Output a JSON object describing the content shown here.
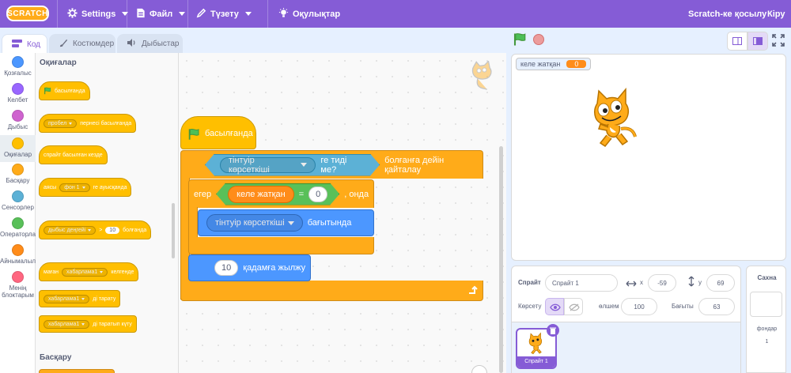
{
  "menu": {
    "logo": "SCRATCH",
    "settings": "Settings",
    "file": "Файл",
    "edit": "Түзету",
    "tutorials": "Оқулықтар",
    "join": "Scratch-ке қосылу",
    "signin": "Кіру"
  },
  "tabs": {
    "code": "Код",
    "costumes": "Костюмдер",
    "sounds": "Дыбыстар"
  },
  "categories": [
    {
      "label": "Қозғалыс",
      "color": "#4c97ff"
    },
    {
      "label": "Келбет",
      "color": "#9966ff"
    },
    {
      "label": "Дыбыс",
      "color": "#cf63cf"
    },
    {
      "label": "Оқиғалар",
      "color": "#ffbf00"
    },
    {
      "label": "Басқару",
      "color": "#ffab19"
    },
    {
      "label": "Сенсорлер",
      "color": "#5cb1d6"
    },
    {
      "label": "Операторлар",
      "color": "#59c059"
    },
    {
      "label": "Айнымалылар",
      "color": "#ff8c1a"
    },
    {
      "label": "Менің блоктарым",
      "color": "#ff6680"
    }
  ],
  "palette": {
    "events_title": "Оқиғалар",
    "control_title": "Басқару",
    "b_flag": "басылғанда",
    "b_key_dd": "пробел",
    "b_key": "пернесі басылғанда",
    "b_sprite_click": "спрайт басылған кезде",
    "b_backdrop_pre": "аясы",
    "b_backdrop_dd": "фон 1",
    "b_backdrop_post": "ге ауысқанда",
    "b_loud_dd": "дыбыс деңгейі",
    "b_loud_op": ">",
    "b_loud_val": "10",
    "b_loud_post": "болғанда",
    "b_recv_pre": "маған",
    "b_recv_dd": "хабарлама1",
    "b_recv_post": "келгенде",
    "b_bcast_dd": "хабарлама1",
    "b_bcast_post": "ді тарату",
    "b_bcastw_dd": "хабарлама1",
    "b_bcastw_post": "ді таратып күту"
  },
  "script": {
    "hat": "басылғанда",
    "repeat_dd": "тінтуір көрсеткіші",
    "repeat_mid": "ге тиді ме?",
    "repeat_post": "болғанға дейін қайталау",
    "if_pre": "егер",
    "var_name": "келе жатқан",
    "eq": "=",
    "eq_val": "0",
    "if_post": ", онда",
    "point_dd": "тінтуір көрсеткіші",
    "point_post": "бағытында",
    "move_val": "10",
    "move_post": "қадамға жылжу"
  },
  "stage": {
    "monitor_label": "келе жатқан",
    "monitor_value": "0"
  },
  "sprite": {
    "label_sprite": "Спрайт",
    "name": "Спрайт 1",
    "x_label": "x",
    "x": "-59",
    "y_label": "y",
    "y": "69",
    "show_label": "Көрсету",
    "size_label": "өлшем",
    "size": "100",
    "dir_label": "Бағыты",
    "direction": "63",
    "thumb_name": "Спрайт 1"
  },
  "stage_pane": {
    "title": "Сахна",
    "backdrops_label": "фондар",
    "backdrops_count": "1"
  }
}
